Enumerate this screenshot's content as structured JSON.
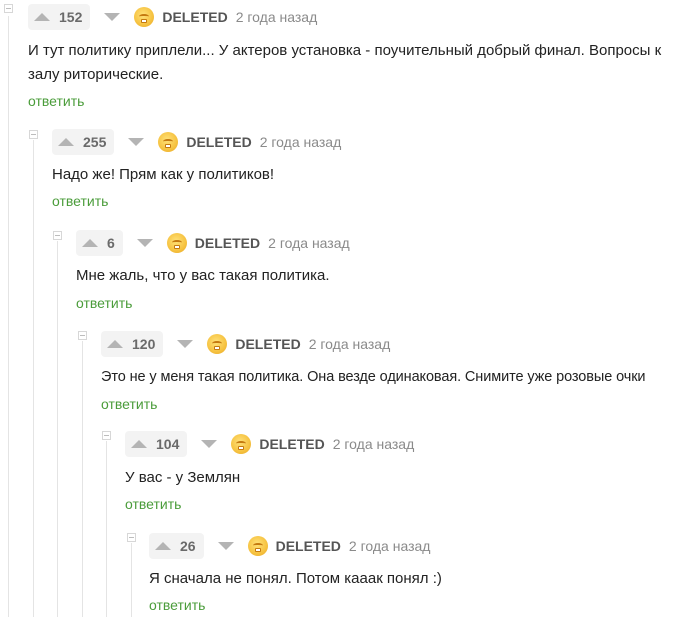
{
  "colors": {
    "reply_link": "#4a9c3a",
    "rating_bg": "#f3f3f3",
    "thread_line": "#e4e4e4"
  },
  "icons": {
    "up": "arrow-up-icon",
    "down": "arrow-down-icon",
    "avatar": "deleted-user-avatar-icon",
    "collapse": "collapse-thread-icon"
  },
  "comments": [
    {
      "rating": "152",
      "username": "DELETED",
      "time": "2 года назад",
      "text_lines": [
        "И тут политику приплели... У актеров установка - поучительный добрый финал. Вопросы к",
        "залу риторические."
      ],
      "reply": "ответить"
    },
    {
      "rating": "255",
      "username": "DELETED",
      "time": "2 года назад",
      "text_lines": [
        "Надо же! Прям как у политиков!"
      ],
      "reply": "ответить"
    },
    {
      "rating": "6",
      "username": "DELETED",
      "time": "2 года назад",
      "text_lines": [
        "Мне жаль, что у вас такая политика."
      ],
      "reply": "ответить"
    },
    {
      "rating": "120",
      "username": "DELETED",
      "time": "2 года назад",
      "text_lines": [
        "Это не у меня такая политика. Она везде одинаковая. Снимите уже розовые очки"
      ],
      "reply": "ответить"
    },
    {
      "rating": "104",
      "username": "DELETED",
      "time": "2 года назад",
      "text_lines": [
        "У вас - у Землян"
      ],
      "reply": "ответить"
    },
    {
      "rating": "26",
      "username": "DELETED",
      "time": "2 года назад",
      "text_lines": [
        "Я сначала не понял. Потом кааак понял :)"
      ],
      "reply": "ответить"
    }
  ]
}
